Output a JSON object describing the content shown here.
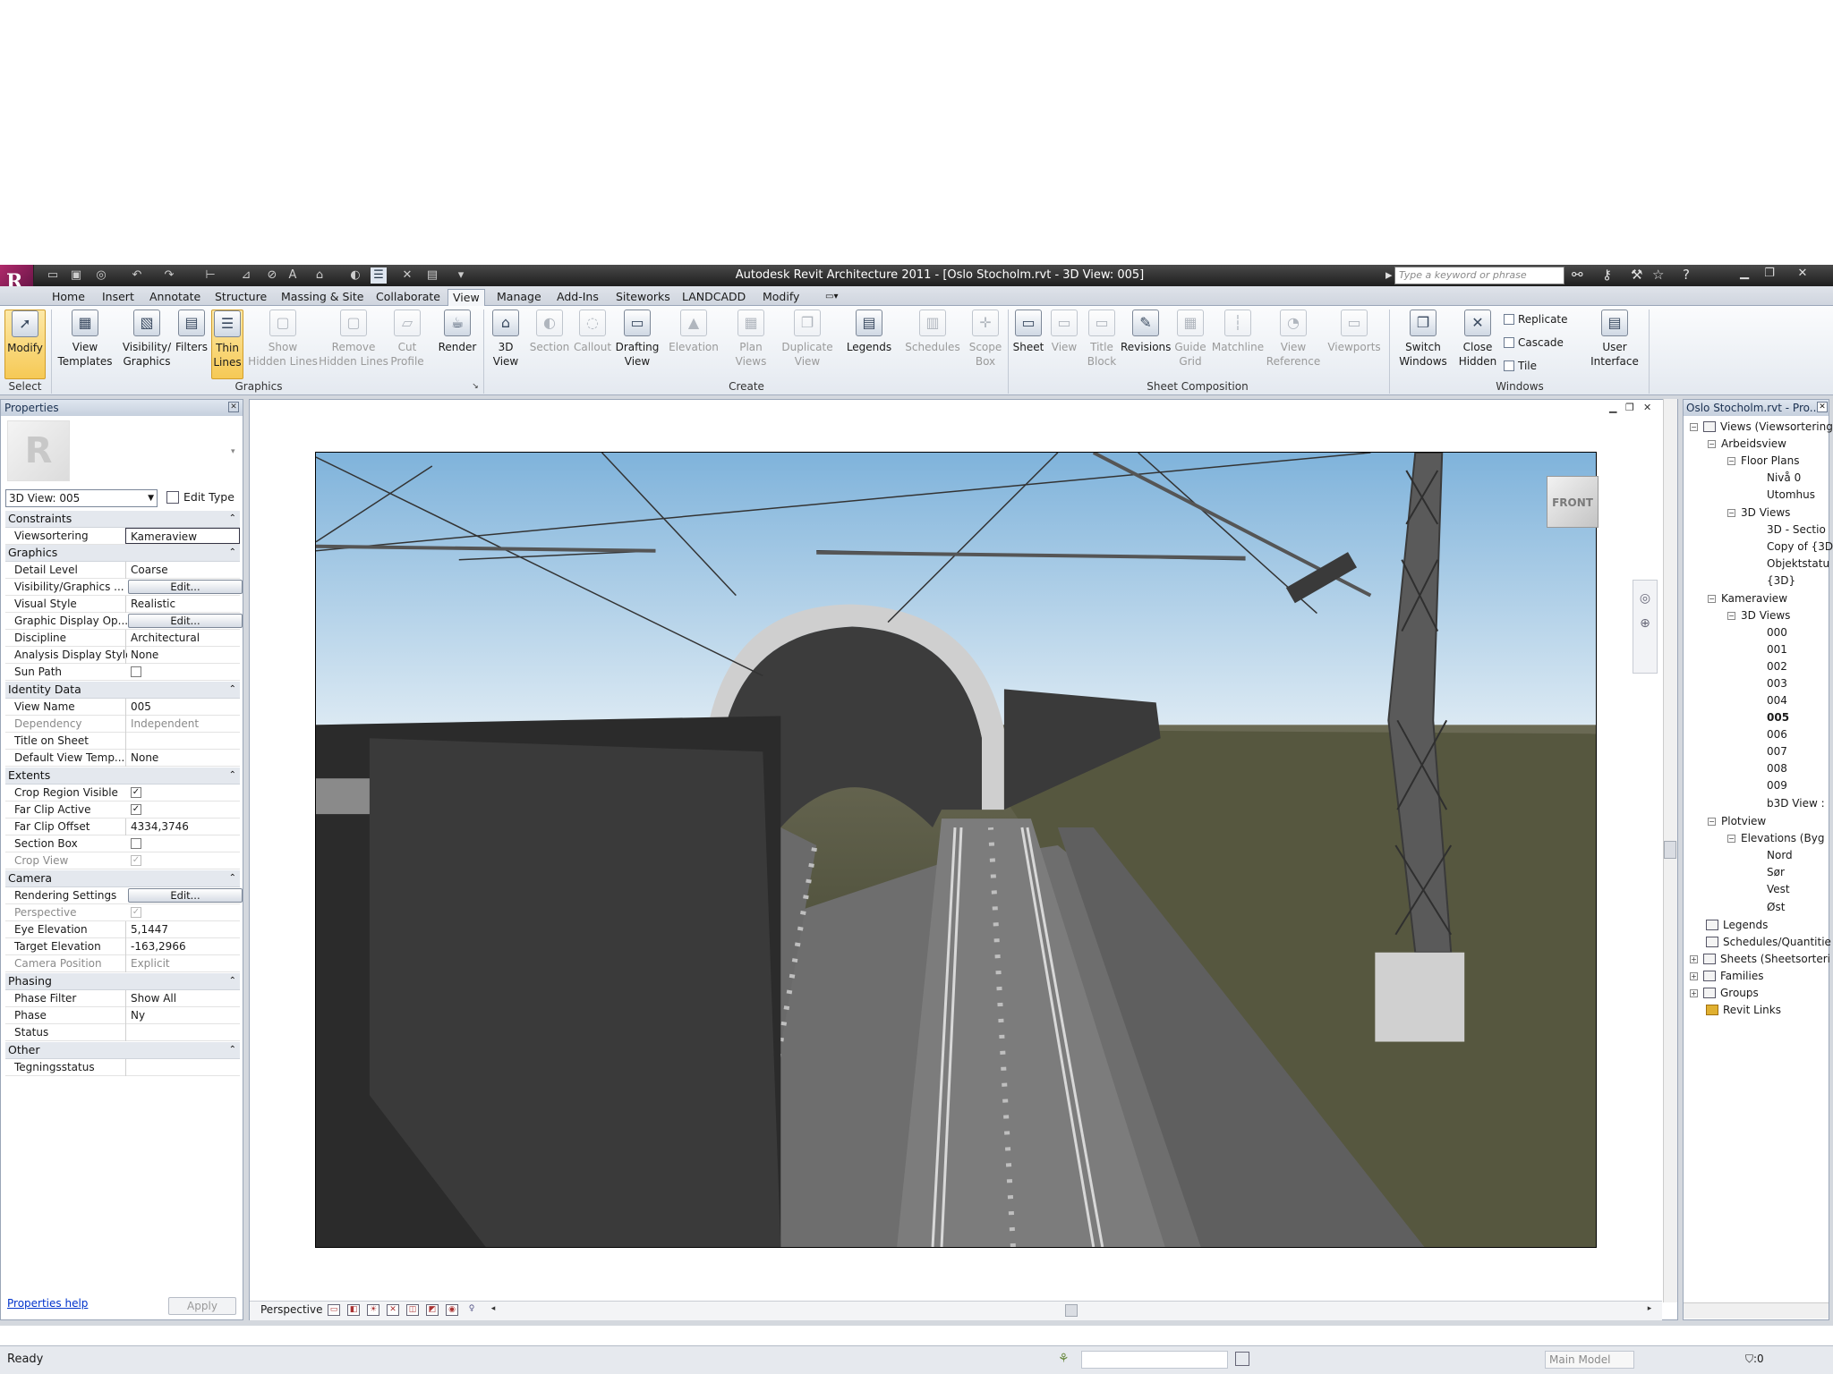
{
  "app": {
    "title": "Autodesk Revit Architecture 2011 - [Oslo Stocholm.rvt - 3D View: 005]",
    "search_placeholder": "Type a keyword or phrase"
  },
  "tabs": [
    "Home",
    "Insert",
    "Annotate",
    "Structure",
    "Massing & Site",
    "Collaborate",
    "View",
    "Manage",
    "Add-Ins",
    "Siteworks",
    "LANDCADD",
    "Modify"
  ],
  "active_tab": "View",
  "ribbon": {
    "select": {
      "modify": "Modify",
      "panel": "Select"
    },
    "graphics": {
      "view_templates": [
        "View",
        "Templates"
      ],
      "visibility_graphics": [
        "Visibility/",
        "Graphics"
      ],
      "filters": "Filters",
      "thin_lines": [
        "Thin",
        "Lines"
      ],
      "show_hidden_lines": [
        "Show",
        "Hidden Lines"
      ],
      "remove_hidden_lines": [
        "Remove",
        "Hidden Lines"
      ],
      "cut_profile": [
        "Cut",
        "Profile"
      ],
      "render": "Render",
      "panel": "Graphics"
    },
    "create": {
      "view_3d": [
        "3D",
        "View"
      ],
      "section": "Section",
      "callout": "Callout",
      "drafting_view": [
        "Drafting",
        "View"
      ],
      "elevation": "Elevation",
      "plan_views": [
        "Plan",
        "Views"
      ],
      "duplicate_view": [
        "Duplicate",
        "View"
      ],
      "legends": "Legends",
      "schedules": "Schedules",
      "scope_box": [
        "Scope",
        "Box"
      ],
      "panel": "Create"
    },
    "sheet_composition": {
      "sheet": "Sheet",
      "view": "View",
      "title_block": [
        "Title",
        "Block"
      ],
      "revisions": "Revisions",
      "guide_grid": [
        "Guide",
        "Grid"
      ],
      "matchline": "Matchline",
      "view_reference": [
        "View",
        "Reference"
      ],
      "viewports": "Viewports",
      "panel": "Sheet Composition"
    },
    "windows": {
      "switch_windows": [
        "Switch",
        "Windows"
      ],
      "close_hidden": [
        "Close",
        "Hidden"
      ],
      "replicate": "Replicate",
      "cascade": "Cascade",
      "tile": "Tile",
      "user_interface": [
        "User",
        "Interface"
      ],
      "panel": "Windows"
    }
  },
  "properties": {
    "header": "Properties",
    "type_selector": "3D View: 005",
    "edit_type": "Edit Type",
    "sections": {
      "constraints": "Constraints",
      "graphics": "Graphics",
      "identity": "Identity Data",
      "extents": "Extents",
      "camera": "Camera",
      "phasing": "Phasing",
      "other": "Other"
    },
    "rows": {
      "viewsortering": {
        "k": "Viewsortering",
        "v": "Kameraview"
      },
      "detail_level": {
        "k": "Detail Level",
        "v": "Coarse"
      },
      "visibility_graphics": {
        "k": "Visibility/Graphics ...",
        "v": "Edit..."
      },
      "visual_style": {
        "k": "Visual Style",
        "v": "Realistic"
      },
      "graphic_display": {
        "k": "Graphic Display Op...",
        "v": "Edit..."
      },
      "discipline": {
        "k": "Discipline",
        "v": "Architectural"
      },
      "analysis_display": {
        "k": "Analysis Display Style",
        "v": "None"
      },
      "sun_path": {
        "k": "Sun Path",
        "v": false
      },
      "view_name": {
        "k": "View Name",
        "v": "005"
      },
      "dependency": {
        "k": "Dependency",
        "v": "Independent"
      },
      "title_on_sheet": {
        "k": "Title on Sheet",
        "v": ""
      },
      "default_view_temp": {
        "k": "Default View Temp...",
        "v": "None"
      },
      "crop_region_visible": {
        "k": "Crop Region Visible",
        "v": true
      },
      "far_clip_active": {
        "k": "Far Clip Active",
        "v": true
      },
      "far_clip_offset": {
        "k": "Far Clip Offset",
        "v": "4334,3746"
      },
      "section_box": {
        "k": "Section Box",
        "v": false
      },
      "crop_view": {
        "k": "Crop View",
        "v": true
      },
      "rendering_settings": {
        "k": "Rendering Settings",
        "v": "Edit..."
      },
      "perspective": {
        "k": "Perspective",
        "v": true
      },
      "eye_elevation": {
        "k": "Eye Elevation",
        "v": "5,1447"
      },
      "target_elevation": {
        "k": "Target Elevation",
        "v": "-163,2966"
      },
      "camera_position": {
        "k": "Camera Position",
        "v": "Explicit"
      },
      "phase_filter": {
        "k": "Phase Filter",
        "v": "Show All"
      },
      "phase": {
        "k": "Phase",
        "v": "Ny"
      },
      "status": {
        "k": "Status",
        "v": ""
      },
      "tegningsstatus": {
        "k": "Tegningsstatus",
        "v": ""
      }
    },
    "help": "Properties help",
    "apply": "Apply"
  },
  "view": {
    "viewcube": "FRONT",
    "perspective_label": "Perspective"
  },
  "project_browser": {
    "header": "Oslo Stocholm.rvt - Pro...",
    "nodes": {
      "views": "Views (Viewsortering",
      "arbeidsview": "Arbeidsview",
      "floor_plans": "Floor Plans",
      "niva0": "Nivå 0",
      "utomhus": "Utomhus",
      "views3d_a": "3D Views",
      "section3d": "3D - Sectio",
      "copy3d": "Copy of {3D",
      "objektstatus": "Objektstatu",
      "v3d": "{3D}",
      "kameraview": "Kameraview",
      "views3d_b": "3D Views",
      "cams": [
        "000",
        "001",
        "002",
        "003",
        "004",
        "005",
        "006",
        "007",
        "008",
        "009",
        "b3D View :"
      ],
      "plotview": "Plotview",
      "elevations": "Elevations (Byg",
      "nord": "Nord",
      "sor": "Sør",
      "vest": "Vest",
      "ost": "Øst",
      "legends": "Legends",
      "schedules": "Schedules/Quantitie",
      "sheets": "Sheets (Sheetsorteri",
      "families": "Families",
      "groups": "Groups",
      "revit_links": "Revit Links"
    }
  },
  "status": {
    "ready": "Ready",
    "main_model": "Main Model",
    "filter_count": ":0"
  }
}
